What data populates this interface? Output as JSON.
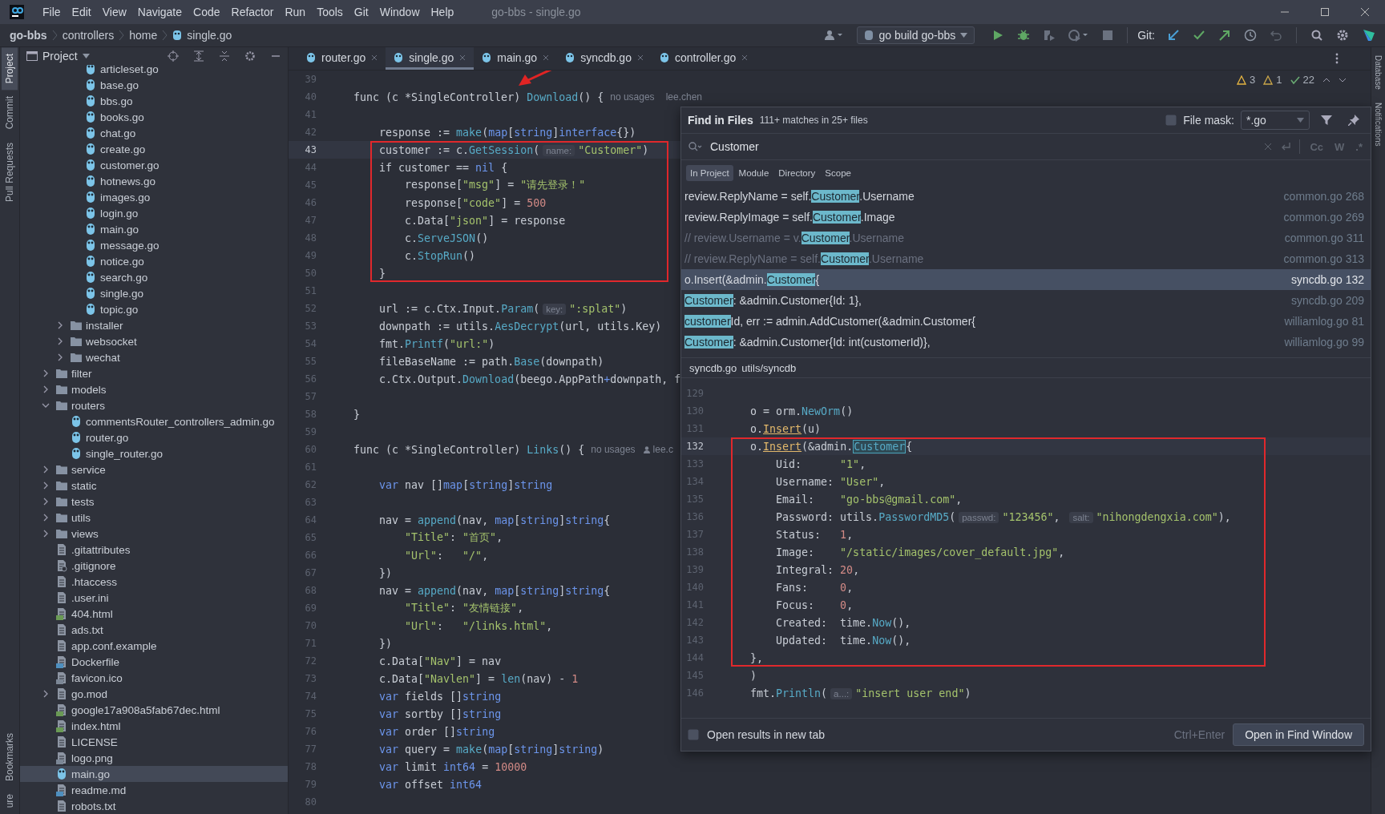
{
  "menu_bar": {
    "items": [
      "File",
      "Edit",
      "View",
      "Navigate",
      "Code",
      "Refactor",
      "Run",
      "Tools",
      "Git",
      "Window",
      "Help"
    ],
    "title": "go-bbs - single.go"
  },
  "breadcrumbs": [
    {
      "label": "go-bbs",
      "kind": "project"
    },
    {
      "label": "controllers",
      "kind": "folder"
    },
    {
      "label": "home",
      "kind": "folder"
    },
    {
      "label": "single.go",
      "kind": "go"
    }
  ],
  "toolbar": {
    "run_config": "go build go-bbs",
    "vcs_label": "Git:"
  },
  "tool_strip_left": [
    {
      "label": "Project",
      "selected": true
    },
    {
      "label": "Commit",
      "selected": false
    },
    {
      "label": "Pull Requests",
      "selected": false
    },
    {
      "label": "Bookmarks",
      "selected": false
    },
    {
      "label": "ure",
      "selected": false
    }
  ],
  "tool_strip_right": [
    "Database",
    "Notifications"
  ],
  "project_panel": {
    "title": "Project",
    "tree": [
      {
        "children": [
          {
            "children": [
              {
                "label": "articleset.go",
                "kind": "go",
                "selected": false
              },
              {
                "label": "base.go",
                "kind": "go",
                "selected": false
              },
              {
                "label": "bbs.go",
                "kind": "go",
                "selected": false
              },
              {
                "label": "books.go",
                "kind": "go",
                "selected": false
              },
              {
                "label": "chat.go",
                "kind": "go",
                "selected": false
              },
              {
                "label": "create.go",
                "kind": "go",
                "selected": false
              },
              {
                "label": "customer.go",
                "kind": "go",
                "selected": false
              },
              {
                "label": "hotnews.go",
                "kind": "go",
                "selected": false
              },
              {
                "label": "images.go",
                "kind": "go",
                "selected": false
              },
              {
                "label": "login.go",
                "kind": "go",
                "selected": false
              },
              {
                "label": "main.go",
                "kind": "go",
                "selected": false
              },
              {
                "label": "message.go",
                "kind": "go",
                "selected": false
              },
              {
                "label": "notice.go",
                "kind": "go",
                "selected": false
              },
              {
                "label": "search.go",
                "kind": "go",
                "selected": false
              },
              {
                "label": "single.go",
                "kind": "go",
                "selected": false
              },
              {
                "label": "topic.go",
                "kind": "go",
                "selected": false
              }
            ]
          },
          {
            "label": "installer",
            "kind": "folder",
            "expanded": false,
            "selected": false
          },
          {
            "label": "websocket",
            "kind": "folder",
            "expanded": false,
            "selected": false
          },
          {
            "label": "wechat",
            "kind": "folder",
            "expanded": false,
            "selected": false
          }
        ]
      },
      {
        "label": "filter",
        "kind": "folder",
        "expanded": false,
        "selected": false
      },
      {
        "label": "models",
        "kind": "folder",
        "expanded": false,
        "selected": false
      },
      {
        "label": "routers",
        "kind": "folder",
        "expanded": true,
        "selected": false,
        "children": [
          {
            "label": "commentsRouter_controllers_admin.go",
            "kind": "go",
            "selected": false
          },
          {
            "label": "router.go",
            "kind": "go",
            "selected": false
          },
          {
            "label": "single_router.go",
            "kind": "go",
            "selected": false
          }
        ]
      },
      {
        "label": "service",
        "kind": "folder",
        "expanded": false,
        "selected": false
      },
      {
        "label": "static",
        "kind": "folder",
        "expanded": false,
        "selected": false
      },
      {
        "label": "tests",
        "kind": "folder",
        "expanded": false,
        "selected": false
      },
      {
        "label": "utils",
        "kind": "folder",
        "expanded": false,
        "selected": false
      },
      {
        "label": "views",
        "kind": "folder",
        "expanded": false,
        "selected": false
      },
      {
        "label": ".gitattributes",
        "kind": "text",
        "selected": false
      },
      {
        "label": ".gitignore",
        "kind": "ignore",
        "selected": false
      },
      {
        "label": ".htaccess",
        "kind": "text",
        "selected": false
      },
      {
        "label": ".user.ini",
        "kind": "text",
        "selected": false
      },
      {
        "label": "404.html",
        "kind": "html",
        "selected": false
      },
      {
        "label": "ads.txt",
        "kind": "text",
        "selected": false
      },
      {
        "label": "app.conf.example",
        "kind": "text",
        "selected": false
      },
      {
        "label": "Dockerfile",
        "kind": "docker",
        "selected": false
      },
      {
        "label": "favicon.ico",
        "kind": "image",
        "selected": false
      },
      {
        "label": "go.mod",
        "kind": "text",
        "expanded": false,
        "selected": false
      },
      {
        "label": "google17a908a5fab67dec.html",
        "kind": "html",
        "selected": false
      },
      {
        "label": "index.html",
        "kind": "html",
        "selected": false
      },
      {
        "label": "LICENSE",
        "kind": "text",
        "selected": false
      },
      {
        "label": "logo.png",
        "kind": "image",
        "selected": false
      },
      {
        "label": "main.go",
        "kind": "go",
        "selected": true
      },
      {
        "label": "readme.md",
        "kind": "md",
        "selected": false
      },
      {
        "label": "robots.txt",
        "kind": "text",
        "selected": false
      }
    ]
  },
  "editor": {
    "tabs": [
      {
        "label": "router.go",
        "selected": false
      },
      {
        "label": "single.go",
        "selected": true
      },
      {
        "label": "main.go",
        "selected": false
      },
      {
        "label": "syncdb.go",
        "selected": false
      },
      {
        "label": "controller.go",
        "selected": false
      }
    ],
    "inspections": {
      "warnings": "3",
      "weak_warnings": "1",
      "passed": "22"
    },
    "lines": [
      {
        "number": "39",
        "current": false,
        "boxed": false
      },
      {
        "number": "40",
        "current": false,
        "boxed": false,
        "tokens": [
          {
            "kind": "plain",
            "text": "func (c *SingleController) "
          },
          {
            "kind": "func",
            "text": "Download"
          },
          {
            "kind": "plain",
            "text": "() {"
          },
          {
            "kind": "note",
            "text": "no usages"
          },
          {
            "kind": "author",
            "text": "lee.chen"
          }
        ]
      },
      {
        "number": "41",
        "current": false,
        "boxed": false
      },
      {
        "number": "42",
        "current": false,
        "boxed": false,
        "tokens": [
          {
            "kind": "plain",
            "text": "    response := "
          },
          {
            "kind": "func",
            "text": "make"
          },
          {
            "kind": "plain",
            "text": "("
          },
          {
            "kind": "keyword",
            "text": "map"
          },
          {
            "kind": "plain",
            "text": "["
          },
          {
            "kind": "keyword",
            "text": "string"
          },
          {
            "kind": "plain",
            "text": "]"
          },
          {
            "kind": "keyword",
            "text": "interface"
          },
          {
            "kind": "plain",
            "text": "{})"
          }
        ]
      },
      {
        "number": "43",
        "current": true,
        "boxed": true,
        "tokens": [
          {
            "kind": "plain",
            "text": "    customer := c."
          },
          {
            "kind": "func",
            "text": "GetSession"
          },
          {
            "kind": "plain",
            "text": "("
          },
          {
            "kind": "hint",
            "text": "name:"
          },
          {
            "kind": "string",
            "text": "\"Customer\""
          },
          {
            "kind": "plain",
            "text": ")"
          }
        ]
      },
      {
        "number": "44",
        "current": false,
        "boxed": true,
        "tokens": [
          {
            "kind": "plain",
            "text": "    if customer == "
          },
          {
            "kind": "keyword",
            "text": "nil"
          },
          {
            "kind": "plain",
            "text": " {"
          }
        ]
      },
      {
        "number": "45",
        "current": false,
        "boxed": true,
        "tokens": [
          {
            "kind": "plain",
            "text": "        response["
          },
          {
            "kind": "string",
            "text": "\"msg\""
          },
          {
            "kind": "plain",
            "text": "] = "
          },
          {
            "kind": "string",
            "text": "\"请先登录！\""
          }
        ]
      },
      {
        "number": "46",
        "current": false,
        "boxed": true,
        "tokens": [
          {
            "kind": "plain",
            "text": "        response["
          },
          {
            "kind": "string",
            "text": "\"code\""
          },
          {
            "kind": "plain",
            "text": "] = "
          },
          {
            "kind": "number",
            "text": "500"
          }
        ]
      },
      {
        "number": "47",
        "current": false,
        "boxed": true,
        "tokens": [
          {
            "kind": "plain",
            "text": "        c.Data["
          },
          {
            "kind": "string",
            "text": "\"json\""
          },
          {
            "kind": "plain",
            "text": "] = response"
          }
        ]
      },
      {
        "number": "48",
        "current": false,
        "boxed": true,
        "tokens": [
          {
            "kind": "plain",
            "text": "        c."
          },
          {
            "kind": "func",
            "text": "ServeJSON"
          },
          {
            "kind": "plain",
            "text": "()"
          }
        ]
      },
      {
        "number": "49",
        "current": false,
        "boxed": true,
        "tokens": [
          {
            "kind": "plain",
            "text": "        c."
          },
          {
            "kind": "func",
            "text": "StopRun"
          },
          {
            "kind": "plain",
            "text": "()"
          }
        ]
      },
      {
        "number": "50",
        "current": false,
        "boxed": true,
        "tokens": [
          {
            "kind": "plain",
            "text": "    }"
          }
        ]
      },
      {
        "number": "51",
        "current": false,
        "boxed": false
      },
      {
        "number": "52",
        "current": false,
        "boxed": false,
        "tokens": [
          {
            "kind": "plain",
            "text": "    url := c.Ctx.Input."
          },
          {
            "kind": "func",
            "text": "Param"
          },
          {
            "kind": "plain",
            "text": "("
          },
          {
            "kind": "hint",
            "text": "key:"
          },
          {
            "kind": "string",
            "text": "\":splat\""
          },
          {
            "kind": "plain",
            "text": ")"
          }
        ]
      },
      {
        "number": "53",
        "current": false,
        "boxed": false,
        "tokens": [
          {
            "kind": "plain",
            "text": "    downpath := utils."
          },
          {
            "kind": "func",
            "text": "AesDecrypt"
          },
          {
            "kind": "plain",
            "text": "(url, utils.Key)"
          }
        ]
      },
      {
        "number": "54",
        "current": false,
        "boxed": false,
        "tokens": [
          {
            "kind": "plain",
            "text": "    fmt."
          },
          {
            "kind": "func",
            "text": "Printf"
          },
          {
            "kind": "plain",
            "text": "("
          },
          {
            "kind": "string",
            "text": "\"url:\""
          },
          {
            "kind": "plain",
            "text": ")"
          }
        ]
      },
      {
        "number": "55",
        "current": false,
        "boxed": false,
        "tokens": [
          {
            "kind": "plain",
            "text": "    fileBaseName := path."
          },
          {
            "kind": "func",
            "text": "Base"
          },
          {
            "kind": "plain",
            "text": "(downpath)"
          }
        ]
      },
      {
        "number": "56",
        "current": false,
        "boxed": false,
        "tokens": [
          {
            "kind": "plain",
            "text": "    c.Ctx.Output."
          },
          {
            "kind": "func",
            "text": "Download"
          },
          {
            "kind": "plain",
            "text": "(beego.AppPath"
          },
          {
            "kind": "keyword",
            "text": "+"
          },
          {
            "kind": "plain",
            "text": "downpath, f"
          }
        ]
      },
      {
        "number": "57",
        "current": false,
        "boxed": false
      },
      {
        "number": "58",
        "current": false,
        "boxed": false,
        "tokens": [
          {
            "kind": "plain",
            "text": "}"
          }
        ]
      },
      {
        "number": "59",
        "current": false,
        "boxed": false
      },
      {
        "number": "60",
        "current": false,
        "boxed": false,
        "tokens": [
          {
            "kind": "plain",
            "text": "func (c *SingleController) "
          },
          {
            "kind": "func",
            "text": "Links"
          },
          {
            "kind": "plain",
            "text": "() {"
          },
          {
            "kind": "note",
            "text": "no usages"
          },
          {
            "kind": "author",
            "text": "lee.c"
          }
        ]
      },
      {
        "number": "61",
        "current": false,
        "boxed": false
      },
      {
        "number": "62",
        "current": false,
        "boxed": false,
        "tokens": [
          {
            "kind": "keyword",
            "text": "    var"
          },
          {
            "kind": "plain",
            "text": " nav []"
          },
          {
            "kind": "keyword",
            "text": "map"
          },
          {
            "kind": "plain",
            "text": "["
          },
          {
            "kind": "keyword",
            "text": "string"
          },
          {
            "kind": "plain",
            "text": "]"
          },
          {
            "kind": "keyword",
            "text": "string"
          }
        ]
      },
      {
        "number": "63",
        "current": false,
        "boxed": false
      },
      {
        "number": "64",
        "current": false,
        "boxed": false,
        "tokens": [
          {
            "kind": "plain",
            "text": "    nav = "
          },
          {
            "kind": "func",
            "text": "append"
          },
          {
            "kind": "plain",
            "text": "(nav, "
          },
          {
            "kind": "keyword",
            "text": "map"
          },
          {
            "kind": "plain",
            "text": "["
          },
          {
            "kind": "keyword",
            "text": "string"
          },
          {
            "kind": "plain",
            "text": "]"
          },
          {
            "kind": "keyword",
            "text": "string"
          },
          {
            "kind": "plain",
            "text": "{"
          }
        ]
      },
      {
        "number": "65",
        "current": false,
        "boxed": false,
        "tokens": [
          {
            "kind": "string",
            "text": "        \"Title\""
          },
          {
            "kind": "plain",
            "text": ": "
          },
          {
            "kind": "string",
            "text": "\"首页\""
          },
          {
            "kind": "plain",
            "text": ","
          }
        ]
      },
      {
        "number": "66",
        "current": false,
        "boxed": false,
        "tokens": [
          {
            "kind": "string",
            "text": "        \"Url\""
          },
          {
            "kind": "plain",
            "text": ":   "
          },
          {
            "kind": "string",
            "text": "\"/\""
          },
          {
            "kind": "plain",
            "text": ","
          }
        ]
      },
      {
        "number": "67",
        "current": false,
        "boxed": false,
        "tokens": [
          {
            "kind": "plain",
            "text": "    })"
          }
        ]
      },
      {
        "number": "68",
        "current": false,
        "boxed": false,
        "tokens": [
          {
            "kind": "plain",
            "text": "    nav = "
          },
          {
            "kind": "func",
            "text": "append"
          },
          {
            "kind": "plain",
            "text": "(nav, "
          },
          {
            "kind": "keyword",
            "text": "map"
          },
          {
            "kind": "plain",
            "text": "["
          },
          {
            "kind": "keyword",
            "text": "string"
          },
          {
            "kind": "plain",
            "text": "]"
          },
          {
            "kind": "keyword",
            "text": "string"
          },
          {
            "kind": "plain",
            "text": "{"
          }
        ]
      },
      {
        "number": "69",
        "current": false,
        "boxed": false,
        "tokens": [
          {
            "kind": "string",
            "text": "        \"Title\""
          },
          {
            "kind": "plain",
            "text": ": "
          },
          {
            "kind": "string",
            "text": "\"友情链接\""
          },
          {
            "kind": "plain",
            "text": ","
          }
        ]
      },
      {
        "number": "70",
        "current": false,
        "boxed": false,
        "tokens": [
          {
            "kind": "string",
            "text": "        \"Url\""
          },
          {
            "kind": "plain",
            "text": ":   "
          },
          {
            "kind": "string",
            "text": "\"/links.html\""
          },
          {
            "kind": "plain",
            "text": ","
          }
        ]
      },
      {
        "number": "71",
        "current": false,
        "boxed": false,
        "tokens": [
          {
            "kind": "plain",
            "text": "    })"
          }
        ]
      },
      {
        "number": "72",
        "current": false,
        "boxed": false,
        "tokens": [
          {
            "kind": "plain",
            "text": "    c.Data["
          },
          {
            "kind": "string",
            "text": "\"Nav\""
          },
          {
            "kind": "plain",
            "text": "] = nav"
          }
        ]
      },
      {
        "number": "73",
        "current": false,
        "boxed": false,
        "tokens": [
          {
            "kind": "plain",
            "text": "    c.Data["
          },
          {
            "kind": "string",
            "text": "\"Navlen\""
          },
          {
            "kind": "plain",
            "text": "] = "
          },
          {
            "kind": "func",
            "text": "len"
          },
          {
            "kind": "plain",
            "text": "(nav) - "
          },
          {
            "kind": "number",
            "text": "1"
          }
        ]
      },
      {
        "number": "74",
        "current": false,
        "boxed": false,
        "tokens": [
          {
            "kind": "keyword",
            "text": "    var"
          },
          {
            "kind": "plain",
            "text": " fields []"
          },
          {
            "kind": "keyword",
            "text": "string"
          }
        ]
      },
      {
        "number": "75",
        "current": false,
        "boxed": false,
        "tokens": [
          {
            "kind": "keyword",
            "text": "    var"
          },
          {
            "kind": "plain",
            "text": " sortby []"
          },
          {
            "kind": "keyword",
            "text": "string"
          }
        ]
      },
      {
        "number": "76",
        "current": false,
        "boxed": false,
        "tokens": [
          {
            "kind": "keyword",
            "text": "    var"
          },
          {
            "kind": "plain",
            "text": " order []"
          },
          {
            "kind": "keyword",
            "text": "string"
          }
        ]
      },
      {
        "number": "77",
        "current": false,
        "boxed": false,
        "tokens": [
          {
            "kind": "keyword",
            "text": "    var"
          },
          {
            "kind": "plain",
            "text": " query = "
          },
          {
            "kind": "func",
            "text": "make"
          },
          {
            "kind": "plain",
            "text": "("
          },
          {
            "kind": "keyword",
            "text": "map"
          },
          {
            "kind": "plain",
            "text": "["
          },
          {
            "kind": "keyword",
            "text": "string"
          },
          {
            "kind": "plain",
            "text": "]"
          },
          {
            "kind": "keyword",
            "text": "string"
          },
          {
            "kind": "plain",
            "text": ")"
          }
        ]
      },
      {
        "number": "78",
        "current": false,
        "boxed": false,
        "tokens": [
          {
            "kind": "keyword",
            "text": "    var"
          },
          {
            "kind": "plain",
            "text": " limit "
          },
          {
            "kind": "keyword",
            "text": "int64"
          },
          {
            "kind": "plain",
            "text": " = "
          },
          {
            "kind": "number",
            "text": "10000"
          }
        ]
      },
      {
        "number": "79",
        "current": false,
        "boxed": false,
        "tokens": [
          {
            "kind": "keyword",
            "text": "    var"
          },
          {
            "kind": "plain",
            "text": " offset "
          },
          {
            "kind": "keyword",
            "text": "int64"
          }
        ]
      },
      {
        "number": "80",
        "current": false,
        "boxed": false
      }
    ]
  },
  "find_popup": {
    "title": "Find in Files",
    "summary": "111+ matches in 25+ files",
    "file_mask": {
      "label": "File mask:",
      "checked": false,
      "value": "*.go"
    },
    "query": "Customer",
    "options": [
      "Cc",
      "W",
      ".*"
    ],
    "scopes": [
      {
        "label": "In Project",
        "selected": true
      },
      {
        "label": "Module",
        "selected": false
      },
      {
        "label": "Directory",
        "selected": false
      },
      {
        "label": "Scope",
        "selected": false
      }
    ],
    "results": [
      {
        "before": "review.ReplyName = self.",
        "match": "Customer",
        "after": ".Username",
        "file": "common.go",
        "line": "268",
        "comment": false,
        "selected": false
      },
      {
        "before": "review.ReplyImage = self.",
        "match": "Customer",
        "after": ".Image",
        "file": "common.go",
        "line": "269",
        "comment": false,
        "selected": false
      },
      {
        "before": "// review.Username = v.",
        "match": "Customer",
        "after": ".Username",
        "file": "common.go",
        "line": "311",
        "comment": true,
        "selected": false
      },
      {
        "before": "// review.ReplyName = self.",
        "match": "Customer",
        "after": ".Username",
        "file": "common.go",
        "line": "313",
        "comment": true,
        "selected": false
      },
      {
        "before": "o.Insert(&admin.",
        "match": "Customer",
        "after": "{",
        "file": "syncdb.go",
        "line": "132",
        "comment": false,
        "selected": true
      },
      {
        "match": "Customer",
        "after": ": &admin.Customer{Id: 1},",
        "file": "syncdb.go",
        "line": "209",
        "comment": false,
        "selected": false
      },
      {
        "match": "customer",
        "after": "Id, err := admin.AddCustomer(&admin.Customer{",
        "file": "williamlog.go",
        "line": "81",
        "comment": false,
        "selected": false
      },
      {
        "match": "Customer",
        "after": ": &admin.Customer{Id: int(customerId)},",
        "file": "williamlog.go",
        "line": "99",
        "comment": false,
        "selected": false
      }
    ],
    "preview": {
      "file": "syncdb.go",
      "path": "utils/syncdb",
      "lines": [
        {
          "number": "129",
          "current": false,
          "boxed": false
        },
        {
          "number": "130",
          "current": false,
          "boxed": false,
          "tokens": [
            {
              "kind": "plain",
              "text": "    o = orm."
            },
            {
              "kind": "func",
              "text": "NewOrm"
            },
            {
              "kind": "plain",
              "text": "()"
            }
          ]
        },
        {
          "number": "131",
          "current": false,
          "boxed": false,
          "tokens": [
            {
              "kind": "plain",
              "text": "    o."
            },
            {
              "kind": "call",
              "text": "Insert"
            },
            {
              "kind": "plain",
              "text": "(u)"
            }
          ]
        },
        {
          "number": "132",
          "current": true,
          "boxed": true,
          "tokens": [
            {
              "kind": "plain",
              "text": "    o."
            },
            {
              "kind": "call",
              "text": "Insert"
            },
            {
              "kind": "plain",
              "text": "(&admin."
            },
            {
              "kind": "match",
              "text": "Customer"
            },
            {
              "kind": "plain",
              "text": "{"
            }
          ]
        },
        {
          "number": "133",
          "current": false,
          "boxed": true,
          "tokens": [
            {
              "kind": "plain",
              "text": "        Uid:      "
            },
            {
              "kind": "string",
              "text": "\"1\""
            },
            {
              "kind": "plain",
              "text": ","
            }
          ]
        },
        {
          "number": "134",
          "current": false,
          "boxed": true,
          "tokens": [
            {
              "kind": "plain",
              "text": "        Username: "
            },
            {
              "kind": "string",
              "text": "\"User\""
            },
            {
              "kind": "plain",
              "text": ","
            }
          ]
        },
        {
          "number": "135",
          "current": false,
          "boxed": true,
          "tokens": [
            {
              "kind": "plain",
              "text": "        Email:    "
            },
            {
              "kind": "string",
              "text": "\"go-bbs@gmail.com\""
            },
            {
              "kind": "plain",
              "text": ","
            }
          ]
        },
        {
          "number": "136",
          "current": false,
          "boxed": true,
          "tokens": [
            {
              "kind": "plain",
              "text": "        Password: utils."
            },
            {
              "kind": "func",
              "text": "PasswordMD5"
            },
            {
              "kind": "plain",
              "text": "("
            },
            {
              "kind": "hint",
              "text": "passwd:"
            },
            {
              "kind": "string",
              "text": "\"123456\""
            },
            {
              "kind": "plain",
              "text": ", "
            },
            {
              "kind": "hint",
              "text": "salt:"
            },
            {
              "kind": "string",
              "text": "\"nihongdengxia.com\""
            },
            {
              "kind": "plain",
              "text": "),"
            }
          ]
        },
        {
          "number": "137",
          "current": false,
          "boxed": true,
          "tokens": [
            {
              "kind": "plain",
              "text": "        Status:   "
            },
            {
              "kind": "number",
              "text": "1"
            },
            {
              "kind": "plain",
              "text": ","
            }
          ]
        },
        {
          "number": "138",
          "current": false,
          "boxed": true,
          "tokens": [
            {
              "kind": "plain",
              "text": "        Image:    "
            },
            {
              "kind": "string",
              "text": "\"/static/images/cover_default.jpg\""
            },
            {
              "kind": "plain",
              "text": ","
            }
          ]
        },
        {
          "number": "139",
          "current": false,
          "boxed": true,
          "tokens": [
            {
              "kind": "plain",
              "text": "        Integral: "
            },
            {
              "kind": "number",
              "text": "20"
            },
            {
              "kind": "plain",
              "text": ","
            }
          ]
        },
        {
          "number": "140",
          "current": false,
          "boxed": true,
          "tokens": [
            {
              "kind": "plain",
              "text": "        Fans:     "
            },
            {
              "kind": "number",
              "text": "0"
            },
            {
              "kind": "plain",
              "text": ","
            }
          ]
        },
        {
          "number": "141",
          "current": false,
          "boxed": true,
          "tokens": [
            {
              "kind": "plain",
              "text": "        Focus:    "
            },
            {
              "kind": "number",
              "text": "0"
            },
            {
              "kind": "plain",
              "text": ","
            }
          ]
        },
        {
          "number": "142",
          "current": false,
          "boxed": true,
          "tokens": [
            {
              "kind": "plain",
              "text": "        Created:  time."
            },
            {
              "kind": "func",
              "text": "Now"
            },
            {
              "kind": "plain",
              "text": "(),"
            }
          ]
        },
        {
          "number": "143",
          "current": false,
          "boxed": true,
          "tokens": [
            {
              "kind": "plain",
              "text": "        Updated:  time."
            },
            {
              "kind": "func",
              "text": "Now"
            },
            {
              "kind": "plain",
              "text": "(),"
            }
          ]
        },
        {
          "number": "144",
          "current": false,
          "boxed": true,
          "tokens": [
            {
              "kind": "plain",
              "text": "    },"
            }
          ]
        },
        {
          "number": "145",
          "current": false,
          "boxed": false,
          "tokens": [
            {
              "kind": "plain",
              "text": "    )"
            }
          ]
        },
        {
          "number": "146",
          "current": false,
          "boxed": false,
          "tokens": [
            {
              "kind": "plain",
              "text": "    fmt."
            },
            {
              "kind": "func",
              "text": "Println"
            },
            {
              "kind": "plain",
              "text": "("
            },
            {
              "kind": "hint",
              "text": "a...:"
            },
            {
              "kind": "string",
              "text": "\"insert user end\""
            },
            {
              "kind": "plain",
              "text": ")"
            }
          ]
        }
      ]
    },
    "new_tab": {
      "label": "Open results in new tab",
      "checked": false
    },
    "shortcut": "Ctrl+Enter",
    "open_button": "Open in Find Window"
  }
}
